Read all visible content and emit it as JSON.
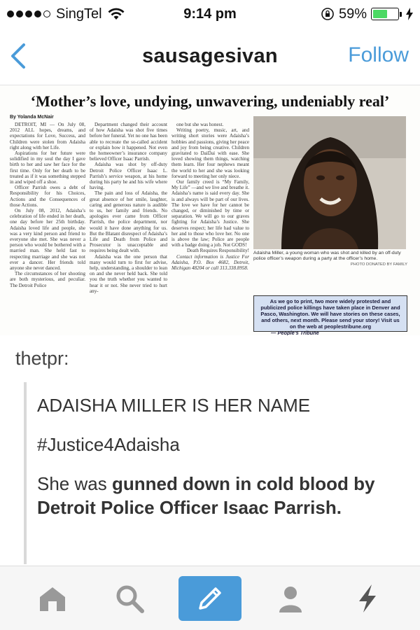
{
  "status_bar": {
    "carrier": "SingTel",
    "time": "9:14 pm",
    "battery_percent": "59%",
    "battery_level": 0.59,
    "signal_bars_filled": 4,
    "signal_bars_total": 5
  },
  "nav": {
    "title": "sausagesivan",
    "follow_label": "Follow",
    "accent_color": "#4a9bd9"
  },
  "clipping": {
    "headline": "‘Mother’s love, undying, unwavering, undeniably real’",
    "byline": "By Yolanda McNair",
    "col1": [
      "DETROIT, MI — On July 08, 2012 ALL hopes, dreams, and expectations for Love, Success, and Children were stolen from Adaisha right along with her Life.",
      "Aspirations for her future were solidified in my soul the day I gave birth to her and saw her face for the first time. Only for her death to be treated as if it was something stepped in and wiped off a shoe.",
      "Officer Parrish owes a debt of Responsibility for his Choices, Actions and the Consequences of those Actions.",
      "On July 08, 2012, Adaisha’s celebration of life ended in her death, one day before her 25th birthday. Adaisha loved life and people, she was a very kind person and friend to everyone she met. She was never a person who would be bothered with a married man. She held fast to respecting marriage and she was not ever a dancer. Her friends told anyone she never danced.",
      "The circumstances of her shooting are both mysterious, and peculiar. The Detroit Police"
    ],
    "col2": [
      "Department changed their account of how Adaisha was shot five times before her funeral. Yet no one has been able to recreate the so-called accident or explain how it happened. Not even the homeowner’s insurance company believed Officer Isaac Parrish.",
      "Adaisha was shot by off-duty Detroit Police Officer Isaac L. Parrish’s service weapon, at his home during his party he and his wife where having.",
      "The pain and loss of Adaisha, the great absence of her smile, laughter, caring and generous nature is audible to us, her family and friends. No apologies ever came from Officer Parrish, the police department, nor would it have done anything for us. But the Blatant disrespect of Adaisha’s Life and Death from Police and Prosecutor is unacceptable and requires being dealt with.",
      "Adaisha was the one person that many would turn to first for advise, help, understanding, a shoulder to lean on and she never held back. She told you the truth whether you wanted to hear it or not. She never tried to hurt any-"
    ],
    "col3": [
      "one but she was honest.",
      "Writing poetry, music, art, and writing short stories were Adaisha’s hobbies and passions, giving her peace and joy from being creative. Children gravitated to DaiDai with ease. She loved showing them things, watching them learn. Her four nephews meant the world to her and she was looking forward to meeting her only niece.",
      "Our family creed is “My Family, My Life” —and we live and breathe it. Adaisha’s name is said every day. She is and always will be part of our lives. The love we have for her cannot be changed, or diminished by time or separation. We will go to our graves fighting for Adaisha’s Justice. She deserves respect; her life had value to her and to those who love her. No one is above the law; Police are people with a badge doing a job. Not GODS!",
      "Death Requires Responsibility!",
      "Contact information is Justice For Adaisha, P.O. Box 4682, Detroit, Michigan 48204 or call 313.338.8958."
    ],
    "photo_caption": "Adaisha Miller, a young woman who was shot and killed by an off-duty police officer’s weapon during a party at the officer’s home.",
    "photo_credit": "PHOTO DONATED BY FAMILY",
    "tribune_box": "As we go to print, two more widely protested and publicized police killings have taken place in Denver and Pasco, Washington. We will have stories on these cases, and others, next month. Please send your story! Visit us on the web at peoplestribune.org",
    "tribune_signature": "— People’s Tribune"
  },
  "post": {
    "author": "thetpr:",
    "line1": "ADAISHA MILLER IS HER NAME",
    "line2": "#Justice4Adaisha",
    "line3_plain": "She was ",
    "line3_bold": "gunned down in cold blood by Detroit Police Officer Isaac Parrish."
  },
  "tab_bar": {
    "tabs": [
      "home-icon",
      "search-icon",
      "compose-icon",
      "account-icon",
      "activity-icon"
    ]
  }
}
